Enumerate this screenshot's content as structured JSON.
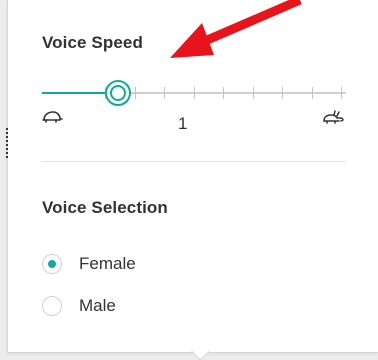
{
  "voice_speed": {
    "heading": "Voice Speed",
    "value_label": "1",
    "slider": {
      "position_fraction": 0.25,
      "tick_count": 9,
      "slow_icon": "turtle-icon",
      "fast_icon": "rabbit-icon"
    }
  },
  "voice_selection": {
    "heading": "Voice Selection",
    "options": [
      {
        "label": "Female",
        "checked": true
      },
      {
        "label": "Male",
        "checked": false
      }
    ]
  },
  "colors": {
    "accent": "#14a89c",
    "annotation": "#e8141b"
  }
}
